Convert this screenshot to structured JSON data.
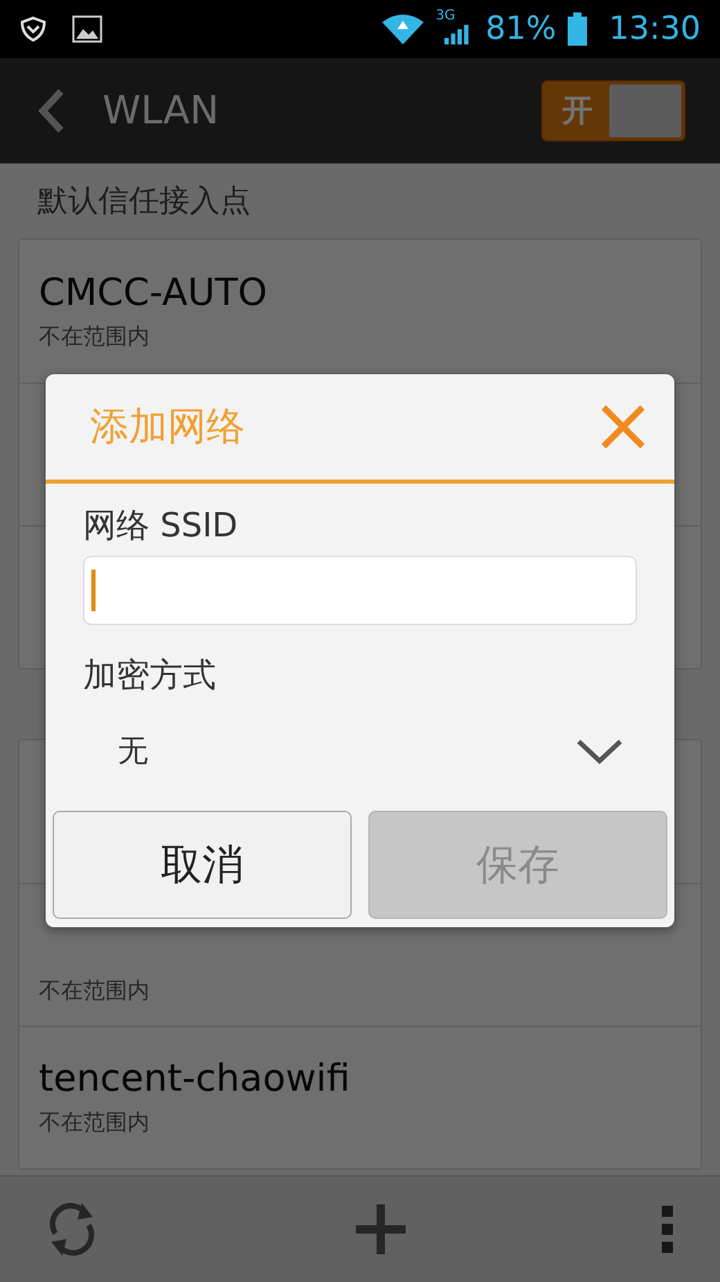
{
  "status_bar": {
    "network": "3G",
    "battery": "81%",
    "time": "13:30"
  },
  "action_bar": {
    "title": "WLAN",
    "switch": {
      "label": "开",
      "on": true
    }
  },
  "sections": [
    {
      "header": "默认信任接入点",
      "networks": [
        {
          "kind": "network",
          "name": "CMCC-AUTO",
          "status": "不在范围内"
        },
        {
          "kind": "covered"
        },
        {
          "kind": "covered"
        }
      ]
    },
    {
      "networks": [
        {
          "kind": "covered"
        },
        {
          "kind": "network",
          "status": "不在范围内"
        },
        {
          "kind": "network",
          "name": "tencent-chaowifi",
          "status": "不在范围内"
        }
      ]
    }
  ],
  "dialog": {
    "title": "添加网络",
    "ssid_label": "网络 SSID",
    "ssid_field": {
      "focused": true
    },
    "security_label": "加密方式",
    "security_value": "无",
    "buttons": [
      {
        "label": "取消",
        "disabled": false
      },
      {
        "label": "保存",
        "disabled": true
      }
    ]
  }
}
